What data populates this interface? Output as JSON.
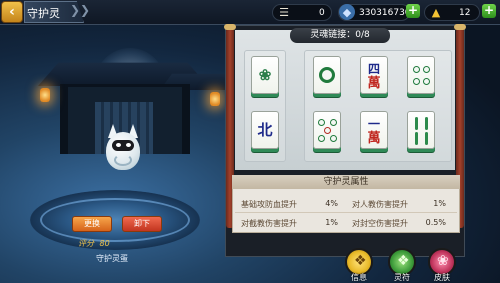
{
  "header": {
    "back_icon": "chevron-left-icon",
    "title": "守护灵"
  },
  "resources": [
    {
      "icon": "scroll-icon",
      "value": "0",
      "color": "#d8d4c8"
    },
    {
      "icon": "diamond-icon",
      "value": "330316730",
      "color": "#8fb4d6"
    },
    {
      "icon": "gold-ingot-icon",
      "value": "12",
      "color": "#f2c234"
    }
  ],
  "board": {
    "link_label": "灵魂链接：0/8",
    "tiles_left": [
      {
        "type": "bird",
        "label": ""
      },
      {
        "type": "honor",
        "label": "北"
      }
    ],
    "tiles_right": [
      {
        "type": "one-circle",
        "label": ""
      },
      {
        "type": "character",
        "top": "四",
        "bottom": "萬"
      },
      {
        "type": "four-circle",
        "label": ""
      },
      {
        "type": "five-circle",
        "label": ""
      },
      {
        "type": "character",
        "top": "一",
        "bottom": "萬"
      },
      {
        "type": "bamboo",
        "label": ""
      }
    ]
  },
  "attributes": {
    "title": "守护灵属性",
    "rows": [
      {
        "left_label": "基础攻防血提升",
        "left_value": "4%",
        "right_label": "对人教伤害提升",
        "right_value": "1%"
      },
      {
        "left_label": "对截教伤害提升",
        "left_value": "1%",
        "right_label": "对封空伤害提升",
        "right_value": "0.5%"
      }
    ]
  },
  "pet": {
    "replace_label": "更换",
    "unequip_label": "卸下",
    "score_label": "评分",
    "score_value": "80",
    "name": "守护灵蛋"
  },
  "bottom_buttons": [
    {
      "label": "信息",
      "icon": "info-icon",
      "color": "#e8b928"
    },
    {
      "label": "灵符",
      "icon": "talisman-icon",
      "color": "#3d9b3a"
    },
    {
      "label": "皮肤",
      "icon": "skin-icon",
      "color": "#c0345c"
    }
  ]
}
